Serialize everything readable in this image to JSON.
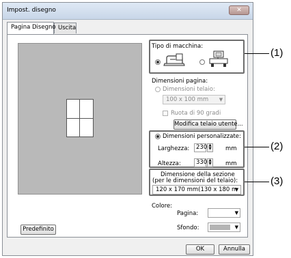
{
  "window": {
    "title": "Impost. disegno",
    "close_label": "✕"
  },
  "tabs": [
    {
      "label": "Pagina Disegno",
      "active": true
    },
    {
      "label": "Uscita",
      "active": false
    }
  ],
  "machine": {
    "label": "Tipo di macchina:",
    "options": [
      {
        "name": "sewing-machine",
        "selected": true
      },
      {
        "name": "embroidery-machine",
        "selected": false
      }
    ]
  },
  "page_size": {
    "label": "Dimensioni pagina:",
    "hoop_radio_label": "Dimensioni telaio:",
    "hoop_value": "100 x 100 mm",
    "rotate_label": "Ruota di 90 gradi",
    "modify_button": "Modifica telaio utente..."
  },
  "custom": {
    "radio_label": "Dimensioni personalizzate:",
    "width_label": "Larghezza:",
    "width_value": "230",
    "height_label": "Altezza:",
    "height_value": "330",
    "unit": "mm"
  },
  "section": {
    "label_line1": "Dimensione della sezione",
    "label_line2": "(per le dimensioni del telaio):",
    "value": "120 x 170 mm(130 x 180 m"
  },
  "colors": {
    "label": "Colore:",
    "page_label": "Pagina:",
    "page_color": "#ffffff",
    "bg_label": "Sfondo:",
    "bg_color": "#b4b4b4"
  },
  "buttons": {
    "default": "Predefinito",
    "ok": "OK",
    "cancel": "Annulla"
  },
  "callouts": [
    "(1)",
    "(2)",
    "(3)"
  ]
}
